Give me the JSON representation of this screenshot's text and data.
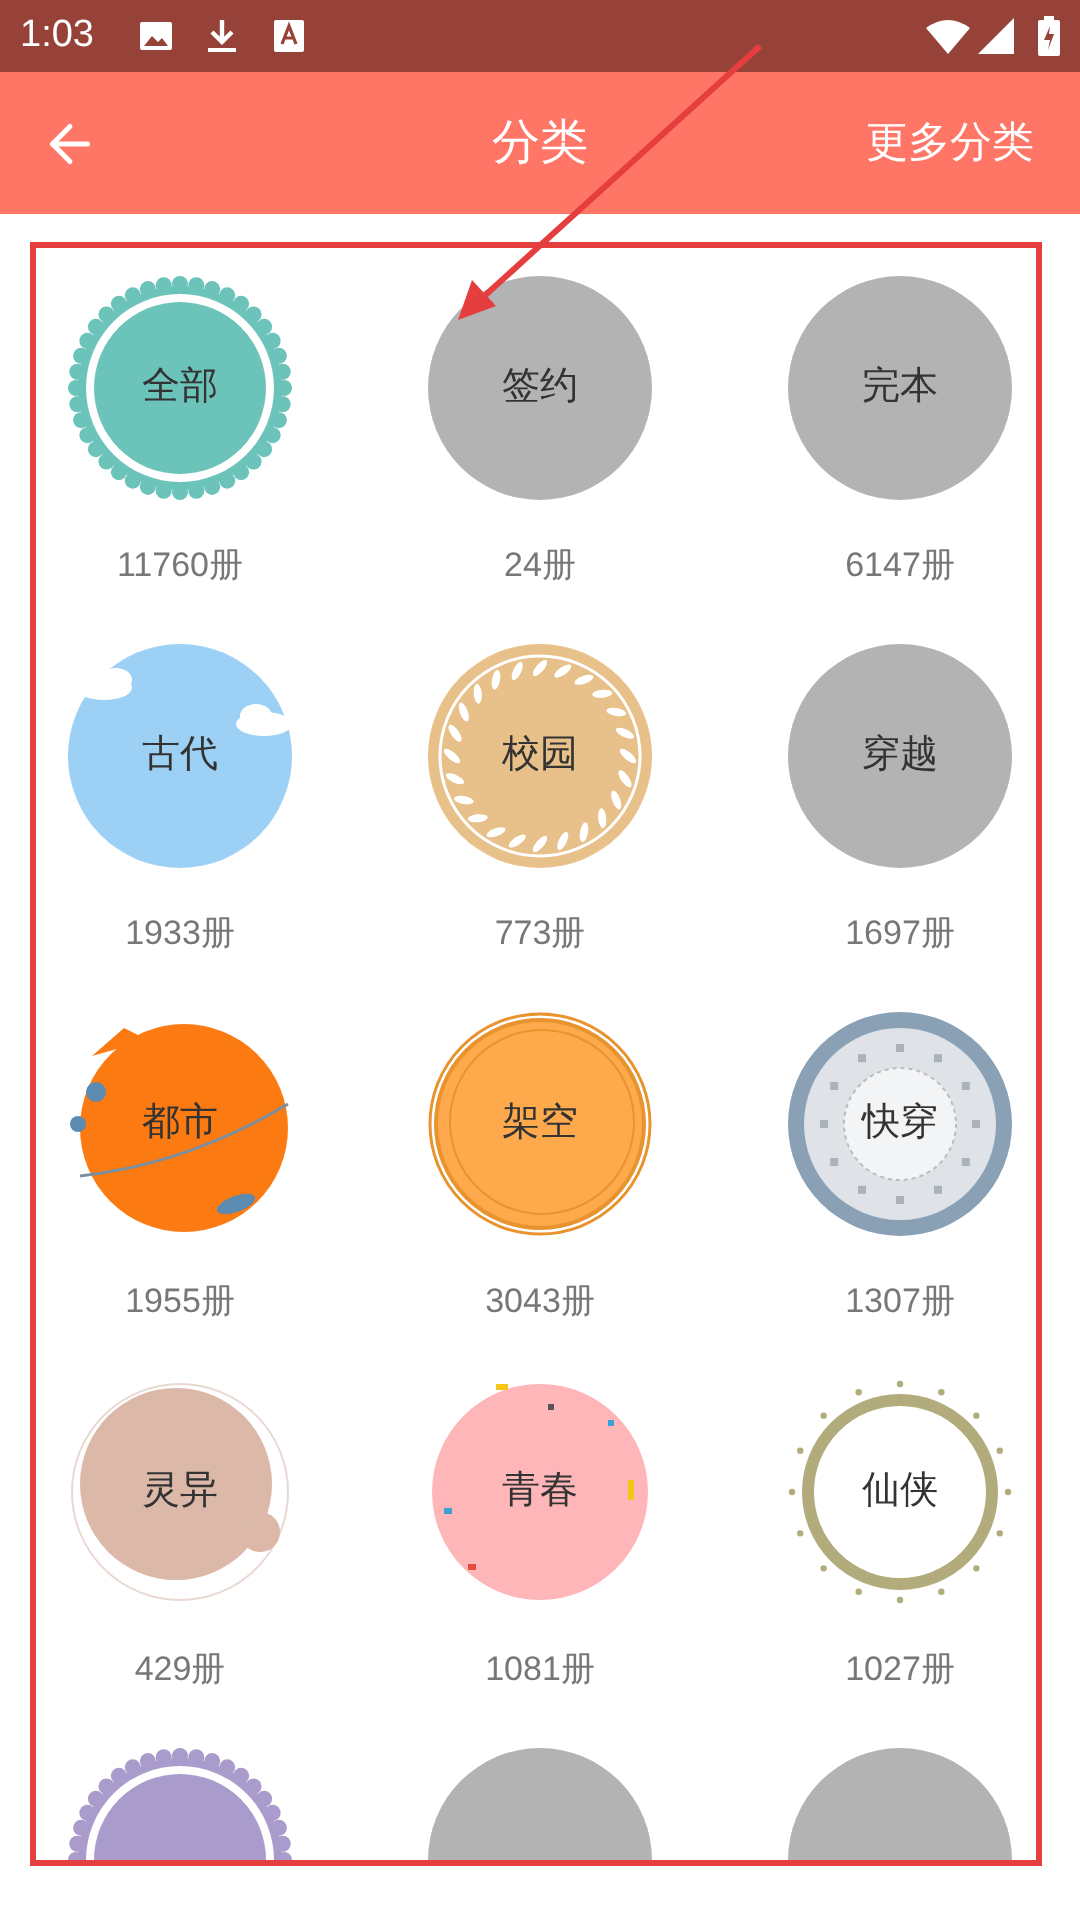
{
  "status_bar": {
    "time": "1:03"
  },
  "header": {
    "title": "分类",
    "action": "更多分类"
  },
  "categories": [
    {
      "name": "全部",
      "count": "11760册",
      "kind": "scallop",
      "color": "#6cc3b9"
    },
    {
      "name": "签约",
      "count": "24册",
      "kind": "plain",
      "color": "#b3b3b3"
    },
    {
      "name": "完本",
      "count": "6147册",
      "kind": "plain",
      "color": "#b3b3b3"
    },
    {
      "name": "古代",
      "count": "1933册",
      "kind": "clouds",
      "color": "#9dd0f5"
    },
    {
      "name": "校园",
      "count": "773册",
      "kind": "wreath",
      "color": "#e8c08a"
    },
    {
      "name": "穿越",
      "count": "1697册",
      "kind": "plain",
      "color": "#b3b3b3"
    },
    {
      "name": "都市",
      "count": "1955册",
      "kind": "planet",
      "color": "#fc7a12"
    },
    {
      "name": "架空",
      "count": "3043册",
      "kind": "rings",
      "color": "#ffa94d"
    },
    {
      "name": "快穿",
      "count": "1307册",
      "kind": "clock",
      "color": "#8aa0b4"
    },
    {
      "name": "灵异",
      "count": "429册",
      "kind": "splash",
      "color": "#dbb8a8"
    },
    {
      "name": "青春",
      "count": "1081册",
      "kind": "confetti",
      "color": "#ffb6b9"
    },
    {
      "name": "仙侠",
      "count": "1027册",
      "kind": "beads",
      "color": "#b2ac7c"
    },
    {
      "kind": "scallop",
      "color": "#a99bcb"
    },
    {
      "kind": "plain",
      "color": "#b3b3b3"
    },
    {
      "kind": "plain",
      "color": "#b3b3b3"
    }
  ]
}
